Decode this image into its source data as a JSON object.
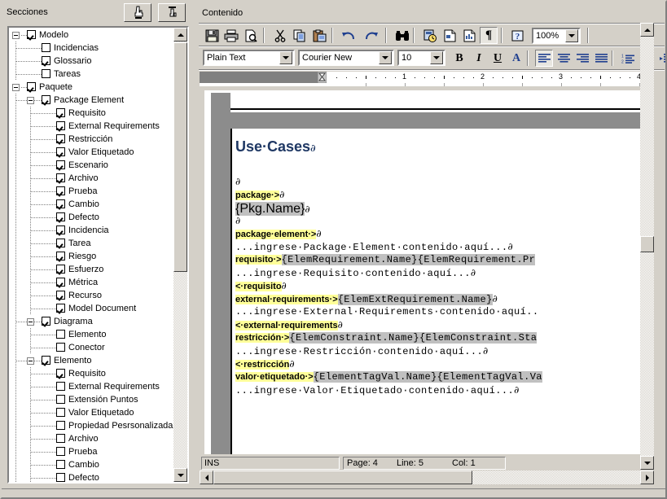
{
  "left": {
    "title": "Secciones",
    "buttons": [
      {
        "name": "collapse-all-button",
        "icon": "hand-pointer-icon",
        "label": ""
      },
      {
        "name": "expand-all-button",
        "icon": "hand-down-icon",
        "label": ""
      }
    ],
    "tree": [
      {
        "label": "Modelo",
        "level": 0,
        "checked": true,
        "expander": "minus"
      },
      {
        "label": "Incidencias",
        "level": 1,
        "checked": false,
        "expander": "none"
      },
      {
        "label": "Glossario",
        "level": 1,
        "checked": true,
        "expander": "none"
      },
      {
        "label": "Tareas",
        "level": 1,
        "checked": false,
        "expander": "none"
      },
      {
        "label": "Paquete",
        "level": 0,
        "checked": true,
        "expander": "minus"
      },
      {
        "label": "Package Element",
        "level": 1,
        "checked": true,
        "expander": "minus"
      },
      {
        "label": "Requisito",
        "level": 2,
        "checked": true,
        "expander": "none"
      },
      {
        "label": "External Requirements",
        "level": 2,
        "checked": true,
        "expander": "none"
      },
      {
        "label": "Restricción",
        "level": 2,
        "checked": true,
        "expander": "none"
      },
      {
        "label": "Valor Etiquetado",
        "level": 2,
        "checked": true,
        "expander": "none"
      },
      {
        "label": "Escenario",
        "level": 2,
        "checked": true,
        "expander": "none"
      },
      {
        "label": "Archivo",
        "level": 2,
        "checked": true,
        "expander": "none"
      },
      {
        "label": "Prueba",
        "level": 2,
        "checked": true,
        "expander": "none"
      },
      {
        "label": "Cambio",
        "level": 2,
        "checked": true,
        "expander": "none"
      },
      {
        "label": "Defecto",
        "level": 2,
        "checked": true,
        "expander": "none"
      },
      {
        "label": "Incidencia",
        "level": 2,
        "checked": true,
        "expander": "none"
      },
      {
        "label": "Tarea",
        "level": 2,
        "checked": true,
        "expander": "none"
      },
      {
        "label": "Riesgo",
        "level": 2,
        "checked": true,
        "expander": "none"
      },
      {
        "label": "Esfuerzo",
        "level": 2,
        "checked": true,
        "expander": "none"
      },
      {
        "label": "Métrica",
        "level": 2,
        "checked": true,
        "expander": "none"
      },
      {
        "label": "Recurso",
        "level": 2,
        "checked": true,
        "expander": "none"
      },
      {
        "label": "Model Document",
        "level": 2,
        "checked": true,
        "expander": "none"
      },
      {
        "label": "Diagrama",
        "level": 1,
        "checked": true,
        "expander": "minus"
      },
      {
        "label": "Elemento",
        "level": 2,
        "checked": false,
        "expander": "none"
      },
      {
        "label": "Conector",
        "level": 2,
        "checked": false,
        "expander": "none"
      },
      {
        "label": "Elemento",
        "level": 1,
        "checked": true,
        "expander": "minus"
      },
      {
        "label": "Requisito",
        "level": 2,
        "checked": true,
        "expander": "none"
      },
      {
        "label": "External Requirements",
        "level": 2,
        "checked": false,
        "expander": "none"
      },
      {
        "label": "Extensión Puntos",
        "level": 2,
        "checked": false,
        "expander": "none"
      },
      {
        "label": "Valor Etiquetado",
        "level": 2,
        "checked": false,
        "expander": "none"
      },
      {
        "label": "Propiedad Pesrsonalizada",
        "level": 2,
        "checked": false,
        "expander": "none"
      },
      {
        "label": "Archivo",
        "level": 2,
        "checked": false,
        "expander": "none"
      },
      {
        "label": "Prueba",
        "level": 2,
        "checked": false,
        "expander": "none"
      },
      {
        "label": "Cambio",
        "level": 2,
        "checked": false,
        "expander": "none"
      },
      {
        "label": "Defecto",
        "level": 2,
        "checked": false,
        "expander": "none"
      }
    ]
  },
  "right": {
    "title": "Contenido",
    "toolbar1": [
      {
        "name": "save-button",
        "icon": "floppy-disk-icon"
      },
      {
        "name": "print-button",
        "icon": "printer-icon"
      },
      {
        "name": "print-preview-button",
        "icon": "print-preview-icon"
      },
      {
        "name": "cut-button",
        "icon": "scissors-icon"
      },
      {
        "name": "copy-button",
        "icon": "copy-icon"
      },
      {
        "name": "paste-button",
        "icon": "clipboard-paste-icon"
      },
      {
        "name": "undo-button",
        "icon": "undo-arrow-icon"
      },
      {
        "name": "redo-button",
        "icon": "redo-arrow-icon"
      },
      {
        "name": "find-button",
        "icon": "binoculars-icon"
      },
      {
        "name": "insert-datestamp-button",
        "icon": "page-clock-icon"
      },
      {
        "name": "insert-page-button",
        "icon": "page-icon"
      },
      {
        "name": "insert-section-button",
        "icon": "page-section-icon"
      },
      {
        "name": "show-marks-button",
        "icon": "pilcrow-icon"
      },
      {
        "name": "help-button",
        "icon": "question-help-icon"
      }
    ],
    "zoom": {
      "value": "100%",
      "name": "zoom-combo"
    },
    "style_combo": {
      "value": "Plain Text"
    },
    "font_combo": {
      "value": "Courier New"
    },
    "size_combo": {
      "value": "10"
    },
    "format_buttons": [
      {
        "name": "bold-button",
        "icon": "bold-icon",
        "glyph": "B"
      },
      {
        "name": "italic-button",
        "icon": "italic-icon",
        "glyph": "I"
      },
      {
        "name": "underline-button",
        "icon": "underline-icon",
        "glyph": "U"
      },
      {
        "name": "font-color-button",
        "icon": "font-color-icon",
        "glyph": "A"
      },
      {
        "name": "align-left-button",
        "icon": "align-left-icon",
        "glyph": ""
      },
      {
        "name": "align-center-button",
        "icon": "align-center-icon",
        "glyph": ""
      },
      {
        "name": "align-right-button",
        "icon": "align-right-icon",
        "glyph": ""
      },
      {
        "name": "align-justify-button",
        "icon": "align-justify-icon",
        "glyph": ""
      },
      {
        "name": "numbered-list-button",
        "icon": "numbered-list-icon",
        "glyph": ""
      },
      {
        "name": "bullet-list-button",
        "icon": "bullet-list-icon",
        "glyph": ""
      },
      {
        "name": "indent-button",
        "icon": "indent-icon",
        "glyph": ""
      }
    ],
    "ruler": {
      "numbers": [
        "1",
        "2",
        "3",
        "4"
      ]
    },
    "document": {
      "heading": "Use·Cases",
      "lines": [
        {
          "id": "l1",
          "text": ""
        },
        {
          "id": "l2",
          "text": "package·>"
        },
        {
          "id": "l3",
          "text": "{Pkg.Name}"
        },
        {
          "id": "l4",
          "text": ""
        },
        {
          "id": "l5",
          "text": "package·element·>"
        },
        {
          "id": "l6",
          "text": "...ingrese·Package·Element·contenido·aquí..."
        },
        {
          "id": "l7a",
          "text": "requisito·>"
        },
        {
          "id": "l7b",
          "text": "{ElemRequirement.Name}{ElemRequirement.Pr"
        },
        {
          "id": "l8",
          "text": "...ingrese·Requisito·contenido·aquí..."
        },
        {
          "id": "l9",
          "text": "<·requisito"
        },
        {
          "id": "l10a",
          "text": "external·requirements·>"
        },
        {
          "id": "l10b",
          "text": "{ElemExtRequirement.Name}"
        },
        {
          "id": "l11",
          "text": "...ingrese·External·Requirements·contenido·aquí.."
        },
        {
          "id": "l12",
          "text": "<·external·requirements"
        },
        {
          "id": "l13a",
          "text": "restricción·>"
        },
        {
          "id": "l13b",
          "text": "{ElemConstraint.Name}{ElemConstraint.Sta"
        },
        {
          "id": "l14",
          "text": "...ingrese·Restricción·contenido·aquí..."
        },
        {
          "id": "l15",
          "text": "<·restricción"
        },
        {
          "id": "l16a",
          "text": "valor·etiquetado·>"
        },
        {
          "id": "l16b",
          "text": "{ElementTagVal.Name}{ElementTagVal.Va"
        },
        {
          "id": "l17",
          "text": "...ingrese·Valor·Etiquetado·contenido·aquí..."
        }
      ],
      "pilcrow": "∂"
    },
    "status": {
      "mode": "INS",
      "page_label": "Page: 4",
      "line_label": "Line: 5",
      "col_label": "Col: 1"
    }
  },
  "colors": {
    "face": "#d4d0c8",
    "heading": "#1f3864",
    "highlight_yellow": "#ffff99",
    "selection_gray": "#c0c0c0",
    "page_margin_gray": "#8c8c8c"
  }
}
